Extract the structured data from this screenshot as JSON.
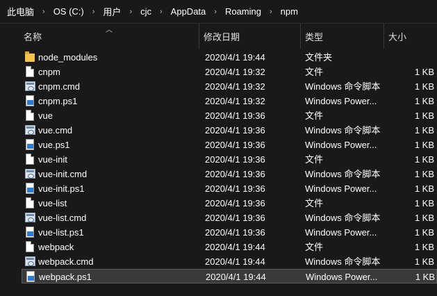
{
  "breadcrumb": {
    "items": [
      "此电脑",
      "OS (C:)",
      "用户",
      "cjc",
      "AppData",
      "Roaming",
      "npm"
    ],
    "separator": "›"
  },
  "columns": {
    "name": "名称",
    "date": "修改日期",
    "type": "类型",
    "size": "大小"
  },
  "files": [
    {
      "name": "node_modules",
      "date": "2020/4/1 19:44",
      "type": "文件夹",
      "size": "",
      "icon": "folder-icon"
    },
    {
      "name": "cnpm",
      "date": "2020/4/1 19:32",
      "type": "文件",
      "size": "1 KB",
      "icon": "file-icon"
    },
    {
      "name": "cnpm.cmd",
      "date": "2020/4/1 19:32",
      "type": "Windows 命令脚本",
      "size": "1 KB",
      "icon": "cmd-script-icon"
    },
    {
      "name": "cnpm.ps1",
      "date": "2020/4/1 19:32",
      "type": "Windows Power...",
      "size": "1 KB",
      "icon": "powershell-script-icon"
    },
    {
      "name": "vue",
      "date": "2020/4/1 19:36",
      "type": "文件",
      "size": "1 KB",
      "icon": "file-icon"
    },
    {
      "name": "vue.cmd",
      "date": "2020/4/1 19:36",
      "type": "Windows 命令脚本",
      "size": "1 KB",
      "icon": "cmd-script-icon"
    },
    {
      "name": "vue.ps1",
      "date": "2020/4/1 19:36",
      "type": "Windows Power...",
      "size": "1 KB",
      "icon": "powershell-script-icon"
    },
    {
      "name": "vue-init",
      "date": "2020/4/1 19:36",
      "type": "文件",
      "size": "1 KB",
      "icon": "file-icon"
    },
    {
      "name": "vue-init.cmd",
      "date": "2020/4/1 19:36",
      "type": "Windows 命令脚本",
      "size": "1 KB",
      "icon": "cmd-script-icon"
    },
    {
      "name": "vue-init.ps1",
      "date": "2020/4/1 19:36",
      "type": "Windows Power...",
      "size": "1 KB",
      "icon": "powershell-script-icon"
    },
    {
      "name": "vue-list",
      "date": "2020/4/1 19:36",
      "type": "文件",
      "size": "1 KB",
      "icon": "file-icon"
    },
    {
      "name": "vue-list.cmd",
      "date": "2020/4/1 19:36",
      "type": "Windows 命令脚本",
      "size": "1 KB",
      "icon": "cmd-script-icon"
    },
    {
      "name": "vue-list.ps1",
      "date": "2020/4/1 19:36",
      "type": "Windows Power...",
      "size": "1 KB",
      "icon": "powershell-script-icon"
    },
    {
      "name": "webpack",
      "date": "2020/4/1 19:44",
      "type": "文件",
      "size": "1 KB",
      "icon": "file-icon"
    },
    {
      "name": "webpack.cmd",
      "date": "2020/4/1 19:44",
      "type": "Windows 命令脚本",
      "size": "1 KB",
      "icon": "cmd-script-icon"
    },
    {
      "name": "webpack.ps1",
      "date": "2020/4/1 19:44",
      "type": "Windows Power...",
      "size": "1 KB",
      "icon": "powershell-script-icon",
      "selected": true
    }
  ],
  "colors": {
    "background": "#191919",
    "selection": "#3a3a3a",
    "text": "#ffffff",
    "folder": "#f4c34c"
  }
}
